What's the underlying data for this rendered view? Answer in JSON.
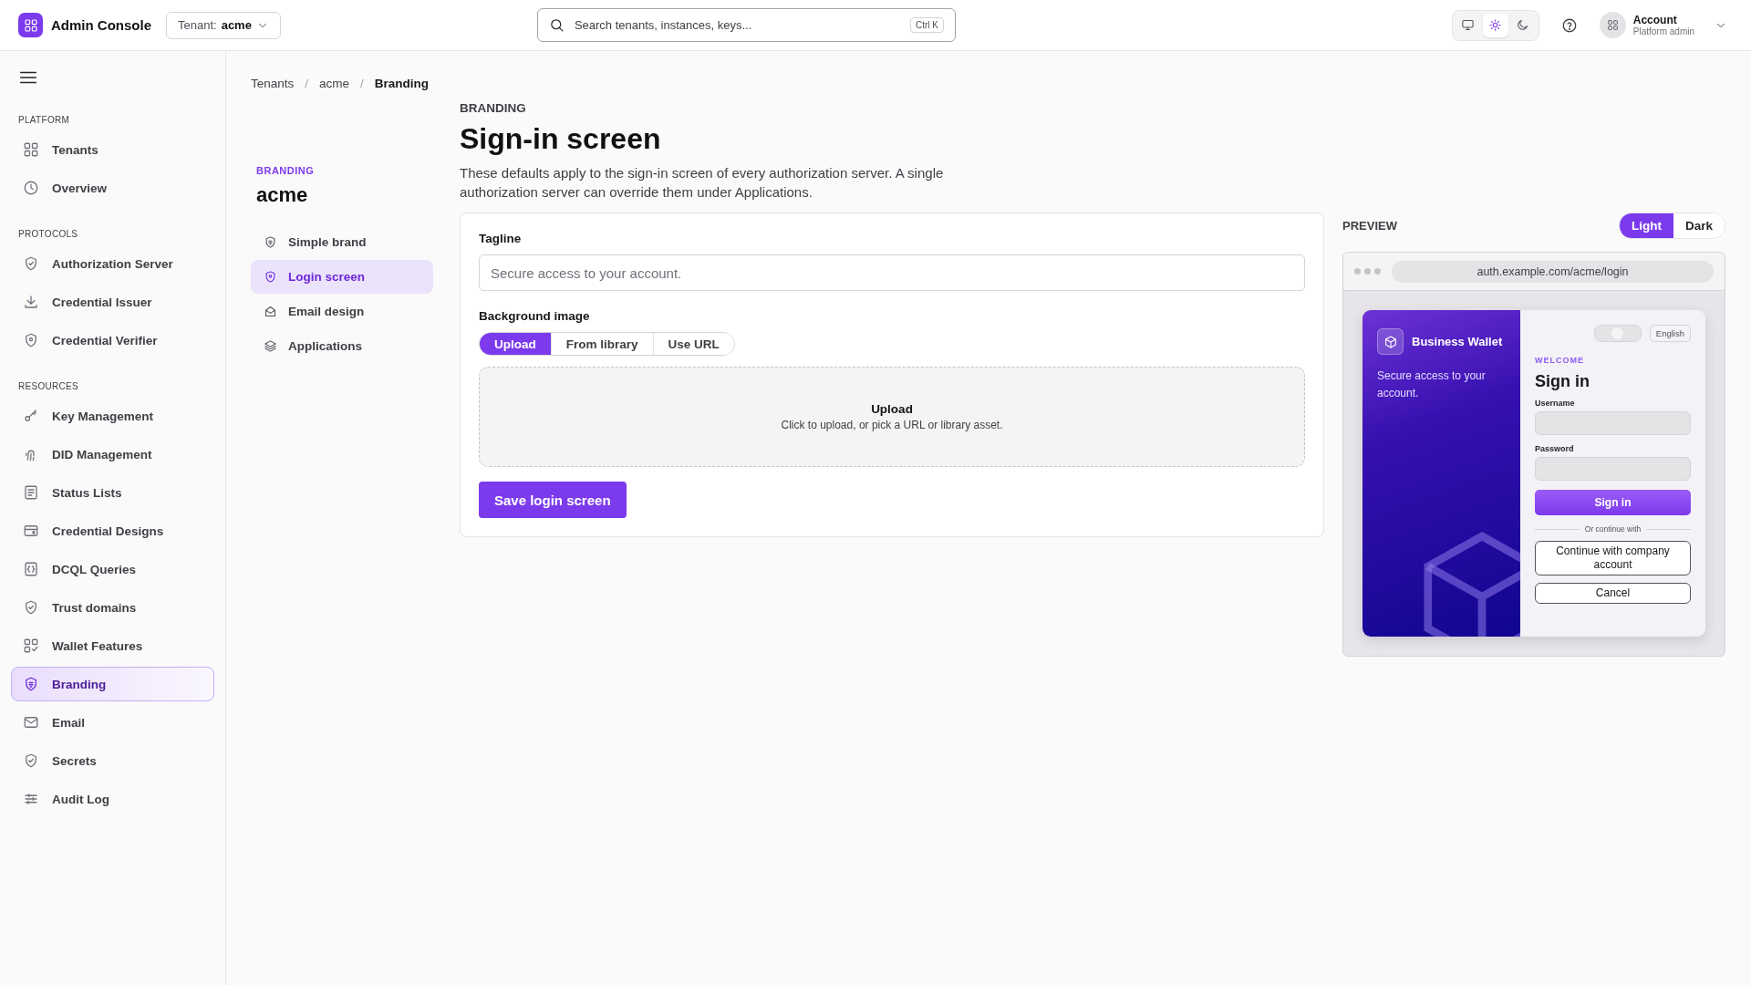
{
  "app": {
    "title": "Admin Console"
  },
  "tenant_select": {
    "label": "Tenant:",
    "value": "acme"
  },
  "search": {
    "placeholder": "Search tenants, instances, keys...",
    "shortcut": "Ctrl K"
  },
  "theme_modes": [
    {
      "selected": false
    },
    {
      "selected": true
    },
    {
      "selected": false
    }
  ],
  "account": {
    "name": "Account",
    "role": "Platform admin"
  },
  "sidebar": {
    "sections": [
      {
        "title": "PLATFORM",
        "items": [
          {
            "label": "Tenants",
            "selected": false
          },
          {
            "label": "Overview",
            "selected": false
          }
        ]
      },
      {
        "title": "PROTOCOLS",
        "items": [
          {
            "label": "Authorization Server",
            "selected": false
          },
          {
            "label": "Credential Issuer",
            "selected": false
          },
          {
            "label": "Credential Verifier",
            "selected": false
          }
        ]
      },
      {
        "title": "RESOURCES",
        "items": [
          {
            "label": "Key Management",
            "selected": false
          },
          {
            "label": "DID Management",
            "selected": false
          },
          {
            "label": "Status Lists",
            "selected": false
          },
          {
            "label": "Credential Designs",
            "selected": false
          },
          {
            "label": "DCQL Queries",
            "selected": false
          },
          {
            "label": "Trust domains",
            "selected": false
          },
          {
            "label": "Wallet Features",
            "selected": false
          },
          {
            "label": "Branding",
            "selected": true
          },
          {
            "label": "Email",
            "selected": false
          },
          {
            "label": "Secrets",
            "selected": false
          },
          {
            "label": "Audit Log",
            "selected": false
          }
        ]
      }
    ]
  },
  "breadcrumb": {
    "items": [
      "Tenants",
      "acme",
      "Branding"
    ],
    "separator": "/"
  },
  "subnav": {
    "eyebrow": "BRANDING",
    "title": "acme",
    "items": [
      {
        "label": "Simple brand",
        "selected": false
      },
      {
        "label": "Login screen",
        "selected": true
      },
      {
        "label": "Email design",
        "selected": false
      },
      {
        "label": "Applications",
        "selected": false
      }
    ]
  },
  "page": {
    "eyebrow": "BRANDING",
    "title": "Sign-in screen",
    "description": "These defaults apply to the sign-in screen of every authorization server. A single authorization server can override them under Applications."
  },
  "form": {
    "tagline_label": "Tagline",
    "tagline_placeholder": "Secure access to your account.",
    "background_label": "Background image",
    "source_tabs": [
      {
        "label": "Upload",
        "selected": true
      },
      {
        "label": "From library",
        "selected": false
      },
      {
        "label": "Use URL",
        "selected": false
      }
    ],
    "dropzone": {
      "title": "Upload",
      "hint": "Click to upload, or pick a URL or library asset."
    },
    "save": "Save login screen"
  },
  "preview": {
    "title": "PREVIEW",
    "modes": [
      {
        "label": "Light",
        "selected": true
      },
      {
        "label": "Dark",
        "selected": false
      }
    ],
    "url": "auth.example.com/acme/login",
    "brand": "Business Wallet",
    "tagline": "Secure access to your account.",
    "language": "English",
    "theme_toggle": {
      "on": false
    },
    "eyebrow": "WELCOME",
    "heading": "Sign in",
    "username_label": "Username",
    "password_label": "Password",
    "submit": "Sign in",
    "divider": "Or continue with",
    "company_button": "Continue with company account",
    "cancel": "Cancel"
  }
}
